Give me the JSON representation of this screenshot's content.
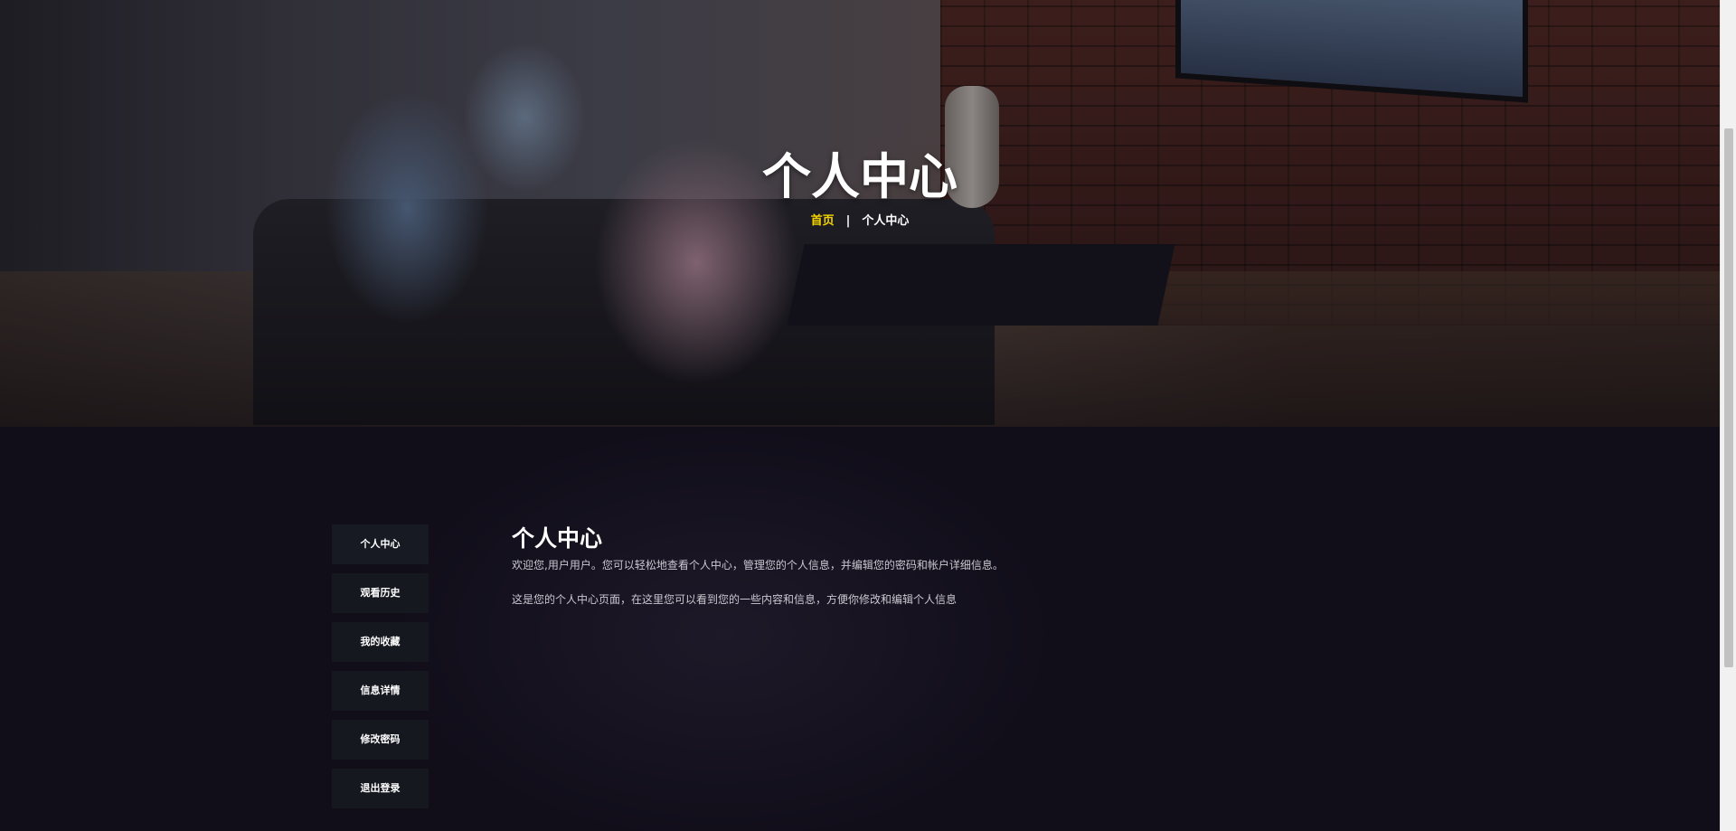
{
  "hero": {
    "title": "个人中心",
    "breadcrumb": {
      "home": "首页",
      "separator": "|",
      "current": "个人中心"
    },
    "image_description_icon": "home-theater-photo"
  },
  "sidebar": {
    "items": [
      {
        "label": "个人中心",
        "active": true
      },
      {
        "label": "观看历史",
        "active": false
      },
      {
        "label": "我的收藏",
        "active": false
      },
      {
        "label": "信息详情",
        "active": false
      },
      {
        "label": "修改密码",
        "active": false
      },
      {
        "label": "退出登录",
        "active": false
      }
    ]
  },
  "content": {
    "title": "个人中心",
    "paragraphs": [
      "欢迎您,用户用户。您可以轻松地查看个人中心，管理您的个人信息，并编辑您的密码和帐户详细信息。",
      "这是您的个人中心页面，在这里您可以看到您的一些内容和信息，方便你修改和编辑个人信息"
    ]
  },
  "colors": {
    "accent": "#f5d400",
    "background": "#110e1a",
    "menu_bg": "#161820",
    "text": "#ffffff",
    "muted_text": "#c9c7cf"
  }
}
